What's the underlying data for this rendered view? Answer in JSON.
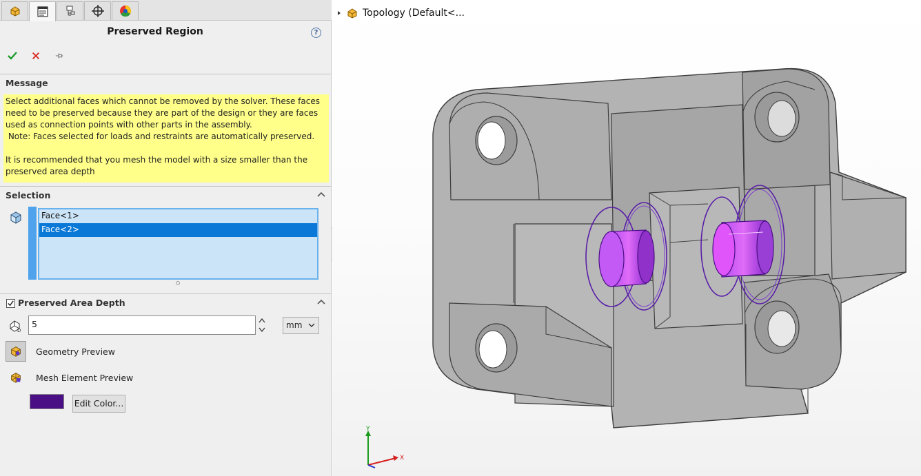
{
  "panel": {
    "tabs": [
      {
        "name": "feature-manager",
        "active": false
      },
      {
        "name": "property-manager",
        "active": true
      },
      {
        "name": "configuration-manager",
        "active": false
      },
      {
        "name": "dimxpert-manager",
        "active": false
      },
      {
        "name": "display-manager",
        "active": false
      }
    ],
    "title": "Preserved Region",
    "help_glyph": "?",
    "sections": {
      "message": {
        "header": "Message",
        "text": "Select additional faces which cannot be removed by the solver. These faces\nneed to be preserved because they are part of the design or they are faces\nused as connection points with other parts in the assembly.\n Note: Faces selected for loads and restraints are automatically preserved.\n\nIt is recommended that you mesh the model with a size smaller than the\npreserved area depth"
      },
      "selection": {
        "header": "Selection",
        "items": [
          "Face<1>",
          "Face<2>"
        ],
        "selected_index": 1
      },
      "depth": {
        "header": "Preserved Area Depth",
        "checked": true,
        "value": "5",
        "unit": "mm",
        "geometry_preview_label": "Geometry Preview",
        "mesh_preview_label": "Mesh Element Preview",
        "color": "#4a0f85",
        "edit_color_label": "Edit Color..."
      }
    }
  },
  "viewport": {
    "tree_label": "Topology  (Default<...",
    "triad": {
      "y_label": "Y",
      "x_label": "X"
    },
    "highlight_color": "#a020f0"
  }
}
